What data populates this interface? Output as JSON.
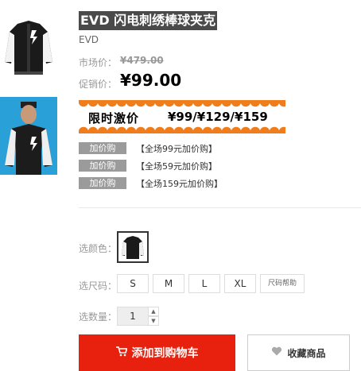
{
  "product": {
    "title": "EVD 闪电刺绣棒球夹克",
    "brand": "EVD",
    "market_label": "市场价：",
    "market_price": "¥479.00",
    "sale_label": "促销价：",
    "sale_price": "¥99.00"
  },
  "banner": {
    "left_text": "限时激价",
    "right_text": "¥99/¥129/¥159"
  },
  "promos": [
    {
      "tag": "加价购",
      "text": "【全场99元加价购】"
    },
    {
      "tag": "加价购",
      "text": "【全场59元加价购】"
    },
    {
      "tag": "加价购",
      "text": "【全场159元加价购】"
    }
  ],
  "options": {
    "color_label": "选颜色：",
    "size_label": "选尺码：",
    "sizes": [
      "S",
      "M",
      "L",
      "XL"
    ],
    "size_help": "尺码帮助",
    "qty_label": "选数量：",
    "qty_value": "1",
    "qty_up": "▲",
    "qty_down": "▼"
  },
  "actions": {
    "cart_label": "添加到购物车",
    "fav_label": "收藏商品"
  },
  "icons": {
    "cart": "cart-icon",
    "heart": "heart-icon"
  },
  "colors": {
    "cart_button": "#e8210e",
    "banner_accent": "#f07d1c",
    "promo_tag": "#9b9b9b",
    "thumb2_bg": "#2aa0d8"
  }
}
